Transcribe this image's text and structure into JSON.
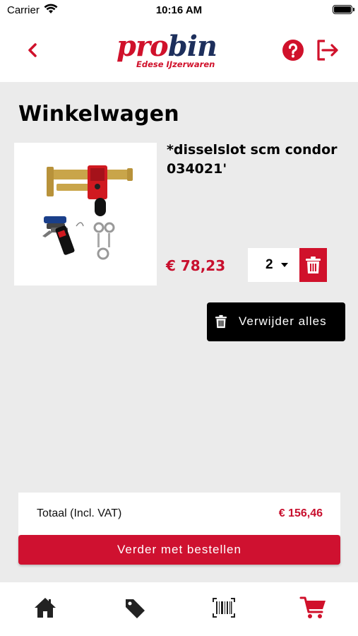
{
  "status_bar": {
    "carrier": "Carrier",
    "time": "10:16 AM"
  },
  "header": {
    "logo_brand_a": "pro",
    "logo_brand_b": "bin",
    "logo_tagline": "Edese IJzerwaren",
    "icons": [
      "back-icon",
      "help-icon",
      "logout-icon"
    ]
  },
  "page": {
    "title": "Winkelwagen"
  },
  "cart": {
    "items": [
      {
        "name": "*disselslot scm condor 034021'",
        "price": "€ 78,23",
        "quantity": "2"
      }
    ],
    "remove_all_label": "Verwijder alles"
  },
  "summary": {
    "total_label": "Totaal (Incl. VAT)",
    "total_value": "€ 156,46"
  },
  "checkout_label": "Verder met bestellen",
  "tabs": [
    {
      "icon": "home-icon"
    },
    {
      "icon": "tag-icon"
    },
    {
      "icon": "barcode-scan-icon"
    },
    {
      "icon": "cart-icon",
      "active": true
    }
  ],
  "colors": {
    "accent": "#d0112b",
    "brand_dark": "#1d2f5c",
    "background": "#ebebeb"
  }
}
